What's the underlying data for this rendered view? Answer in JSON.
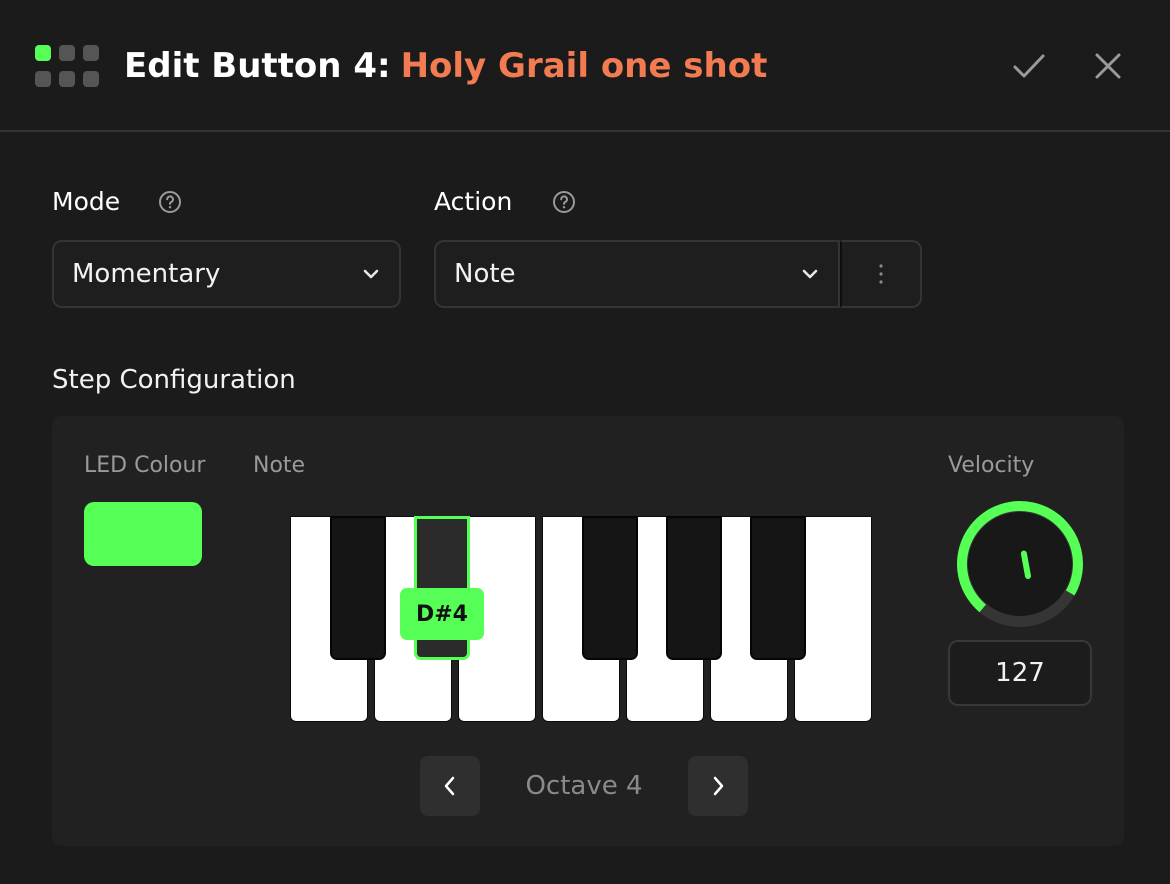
{
  "header": {
    "title_prefix": "Edit Button 4:",
    "title_name": "Holy Grail one shot",
    "confirm_icon": "checkmark-icon",
    "close_icon": "close-icon",
    "accent_color": "#f27b52"
  },
  "mode": {
    "label": "Mode",
    "value": "Momentary"
  },
  "action": {
    "label": "Action",
    "value": "Note"
  },
  "step_config": {
    "title": "Step Configuration",
    "led_label": "LED Colour",
    "led_color": "#55ff55",
    "note_label": "Note",
    "selected_note": "D#4",
    "octave_label": "Octave 4",
    "velocity_label": "Velocity",
    "velocity_value": "127",
    "velocity_level": 1.0
  }
}
